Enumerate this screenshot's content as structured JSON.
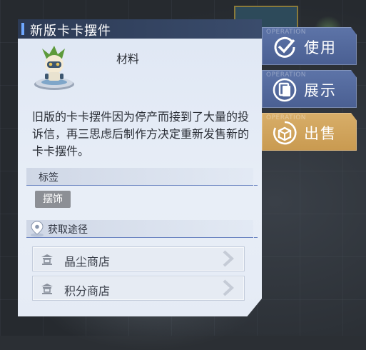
{
  "card": {
    "title": "新版卡卡摆件",
    "category": "材料",
    "description": "旧版的卡卡摆件因为停产而接到了大量的投诉信，再三思虑后制作方决定重新发售新的卡卡摆件。",
    "tags_header": "标签",
    "tags": [
      "摆饰"
    ],
    "source_header": "获取途径",
    "sources": [
      {
        "label": "晶尘商店",
        "icon": "shop-icon"
      },
      {
        "label": "积分商店",
        "icon": "shop-icon"
      }
    ]
  },
  "side_buttons": [
    {
      "op": "OPERATION",
      "label": "使用",
      "icon": "check-icon",
      "style": "blue"
    },
    {
      "op": "OPERATION",
      "label": "展示",
      "icon": "copy-icon",
      "style": "blue"
    },
    {
      "op": "OPERATION",
      "label": "出售",
      "icon": "sell-icon",
      "style": "gold"
    }
  ],
  "colors": {
    "card_header": "#2c3a54",
    "accent_blue": "#6fa8ff",
    "button_blue": "#5068a0",
    "button_gold": "#d4a862"
  }
}
